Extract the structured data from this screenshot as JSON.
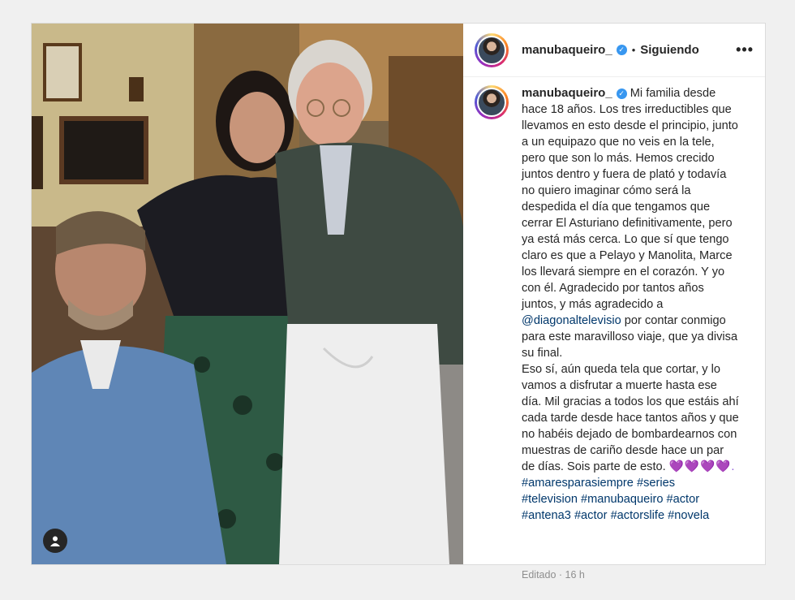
{
  "post": {
    "username": "manubaqueiro_",
    "verified_mark": "✓",
    "dot": "•",
    "follow_status": "Siguiendo",
    "more": "•••",
    "caption_p1": "Mi familia desde hace 18 años. Los tres irreductibles que llevamos en esto desde el principio, junto a un equipazo que no veis en la tele, pero que son lo más. Hemos crecido juntos dentro y fuera de plató y todavía no quiero imaginar cómo será la despedida el día que tengamos que cerrar El Asturiano definitivamente, pero ya está más cerca. Lo que sí que tengo claro es que a Pelayo y Manolita, Marce los llevará siempre en el corazón. Y yo con él. Agradecido por tantos años juntos, y más agradecido a",
    "mention": "@diagonaltelevisio",
    "caption_p2": "por contar conmigo para este maravilloso viaje, que ya divisa su final.",
    "caption_p3": "Eso sí, aún queda tela que cortar, y lo vamos a disfrutar a muerte hasta ese día. Mil gracias a todos los que estáis ahí cada tarde desde hace tantos años y que no habéis dejado de bombardearnos con muestras de cariño desde hace un par de días. Sois parte de esto.",
    "hearts": "💜💜💜💜.",
    "hashtags": [
      "#amaresparasiempre",
      "#series",
      "#television",
      "#manubaqueiro",
      "#actor",
      "#antena3",
      "#actor",
      "#actorslife",
      "#novela"
    ],
    "edited": "Editado",
    "time": "16 h"
  },
  "colors": {
    "link": "#00376b",
    "verified": "#3897f0",
    "heart": "#8e5bd8"
  }
}
